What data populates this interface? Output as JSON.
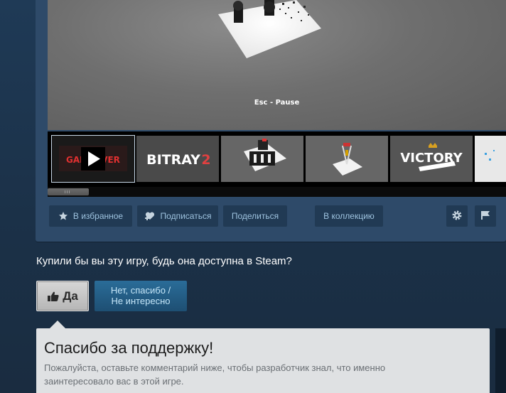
{
  "video": {
    "pause_text": "Esc - Pause"
  },
  "thumbnails": [
    {
      "kind": "video",
      "text": "GAMEOVER",
      "selected": true
    },
    {
      "kind": "logo",
      "text": "BITRAY",
      "number": "2"
    },
    {
      "kind": "screenshot"
    },
    {
      "kind": "screenshot"
    },
    {
      "kind": "logo",
      "text": "VICTORY"
    },
    {
      "kind": "partial"
    }
  ],
  "actions": {
    "wishlist": {
      "label": "В избранное",
      "icon": "star-icon"
    },
    "follow": {
      "label": "Подписаться",
      "icon": "heart-plus-icon"
    },
    "share": {
      "label": "Поделиться"
    },
    "collection": {
      "label": "В коллекцию"
    },
    "settings": {
      "icon": "gear-icon"
    },
    "report": {
      "icon": "flag-icon"
    }
  },
  "poll": {
    "question": "Купили бы вы эту игру, будь она доступна в Steam?",
    "yes_label": "Да",
    "no_label_line1": "Нет, спасибо /",
    "no_label_line2": "Не интересно"
  },
  "thanks": {
    "title": "Спасибо за поддержку!",
    "text": "Пожалуйста, оставьте комментарий ниже, чтобы разработчик знал, что именно заинтересовало вас в этой игре."
  },
  "colors": {
    "accent": "#67c1f5",
    "panel": "#2e4a69",
    "button": "#213a54"
  }
}
